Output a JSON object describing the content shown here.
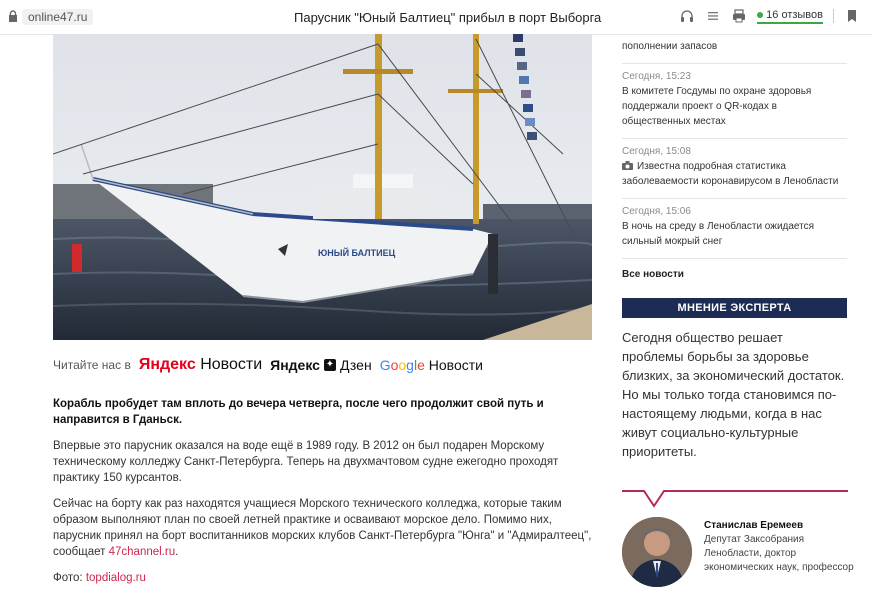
{
  "browser": {
    "domain": "online47.ru",
    "title": "Парусник \"Юный Балтиец\" прибыл в порт Выборга",
    "reviews": "16 отзывов",
    "accent": "#39a845"
  },
  "read_us": {
    "label": "Читайте нас в",
    "yandex_news_brand": "Яндекс",
    "yandex_news_word": "Новости",
    "yandex_zen_brand": "Яндекс",
    "yandex_zen_word": "Дзен",
    "google_news_word": "Новости"
  },
  "article": {
    "lead": "Корабль пробудет там вплоть до вечера четверга, после чего продолжит свой путь и направится в Гданьск.",
    "p1": "Впервые это парусник оказался на воде ещё в 1989 году. В 2012 он был подарен Морскому техническому колледжу Санкт-Петербурга. Теперь на двухмачтовом судне ежегодно проходят практику 150 курсантов.",
    "p2_text": "Сейчас на борту как раз находятся учащиеся Морского технического колледжа, которые таким образом выполняют план по своей летней практике и осваивают морское дело. Помимо них, парусник принял на борт воспитанников морских клубов Санкт-Петербурга \"Юнга\" и \"Адмиралтеец\", сообщает",
    "p2_link": "47channel.ru",
    "p2_end": ".",
    "photo_label": "Фото:",
    "photo_link": "topdialog.ru",
    "ship_name": "ЮНЫЙ БАЛТИЕЦ",
    "link_color": "#d0254d"
  },
  "sidebar": {
    "partial_item": "пополнении запасов",
    "news": [
      {
        "time": "Сегодня, 15:23",
        "text": "В комитете Госдумы по охране здоровья поддержали проект о QR-кодах в общественных местах",
        "has_photo": false
      },
      {
        "time": "Сегодня, 15:08",
        "text": "Известна подробная статистика заболеваемости коронавирусом в Ленобласти",
        "has_photo": true
      },
      {
        "time": "Сегодня, 15:06",
        "text": "В ночь на среду в Ленобласти ожидается сильный мокрый снег",
        "has_photo": false
      }
    ],
    "all_news": "Все новости",
    "expert_header": "МНЕНИЕ ЭКСПЕРТА",
    "expert_quote": "Сегодня общество решает проблемы борьбы за здоровье близких, за экономический достаток. Но мы только тогда становимся по-настоящему людьми, когда в нас живут социально-культурные приоритеты.",
    "expert_name": "Станислав Еремеев",
    "expert_title": "Депутат Заксобрания Ленобласти, доктор экономических наук, профессор",
    "header_color": "#1c2c54",
    "accent_color": "#b5285a"
  }
}
